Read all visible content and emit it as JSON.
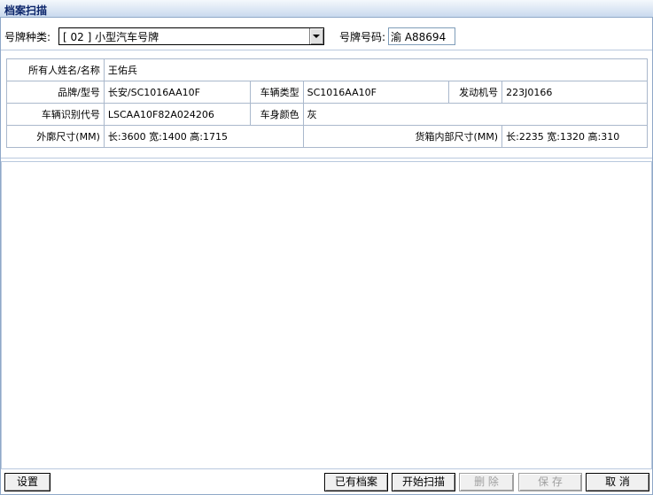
{
  "window": {
    "title": "档案扫描"
  },
  "toolbar": {
    "plate_type_label": "号牌种类:",
    "plate_type_value": "[ 02 ] 小型汽车号牌",
    "plate_number_label": "号牌号码:",
    "plate_number_value": "渝 A88694"
  },
  "vehicle": {
    "owner_label": "所有人姓名/名称",
    "owner_value": "王佑兵",
    "brand_label": "品牌/型号",
    "brand_value": "长安/SC1016AA10F",
    "vtype_label": "车辆类型",
    "vtype_value": "SC1016AA10F",
    "engine_label": "发动机号",
    "engine_value": "223J0166",
    "vin_label": "车辆识别代号",
    "vin_value": "LSCAA10F82A024206",
    "color_label": "车身颜色",
    "color_value": "灰",
    "outer_label": "外廓尺寸(MM)",
    "outer_value": "长:3600 宽:1400 高:1715",
    "cargo_label": "货箱内部尺寸(MM)",
    "cargo_value": "长:2235 宽:1320 高:310"
  },
  "buttons": {
    "settings": "设置",
    "existing": "已有档案",
    "start_scan": "开始扫描",
    "delete": "删 除",
    "save": "保 存",
    "cancel": "取 消"
  }
}
